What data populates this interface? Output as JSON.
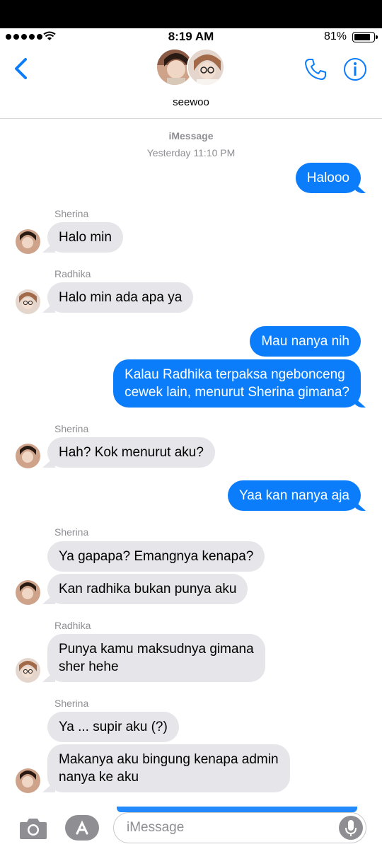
{
  "status": {
    "time": "8:19 AM",
    "battery": "81%"
  },
  "header": {
    "name": "seewoo"
  },
  "thread": {
    "service": "iMessage",
    "timestamp": "Yesterday 11:10 PM"
  },
  "messages": [
    {
      "from": "me",
      "text": "Halooo"
    },
    {
      "from": "Sherina",
      "text": "Halo min"
    },
    {
      "from": "Radhika",
      "text": "Halo min ada apa ya"
    },
    {
      "from": "me",
      "text": "Mau nanya nih"
    },
    {
      "from": "me",
      "line1": "Kalau Radhika terpaksa ngebonceng",
      "line2": "cewek lain, menurut Sherina gimana?"
    },
    {
      "from": "Sherina",
      "text": "Hah? Kok menurut aku?"
    },
    {
      "from": "me",
      "text": "Yaa kan nanya aja"
    },
    {
      "from": "Sherina",
      "text": "Ya gapapa? Emangnya kenapa?"
    },
    {
      "from": "Sherina",
      "text": "Kan radhika bukan punya aku"
    },
    {
      "from": "Radhika",
      "line1": "Punya kamu maksudnya gimana",
      "line2": "sher hehe"
    },
    {
      "from": "Sherina",
      "text": "Ya ... supir aku (?)"
    },
    {
      "from": "Sherina",
      "line1": "Makanya aku bingung kenapa admin",
      "line2": "nanya ke aku"
    }
  ],
  "input": {
    "placeholder": "iMessage"
  },
  "colors": {
    "accent": "#0b7dfb",
    "incoming": "#e5e5ea",
    "meta": "#8e8e93"
  },
  "icons": [
    "back-chevron-icon",
    "phone-icon",
    "info-icon",
    "camera-icon",
    "app-store-icon",
    "microphone-icon"
  ]
}
